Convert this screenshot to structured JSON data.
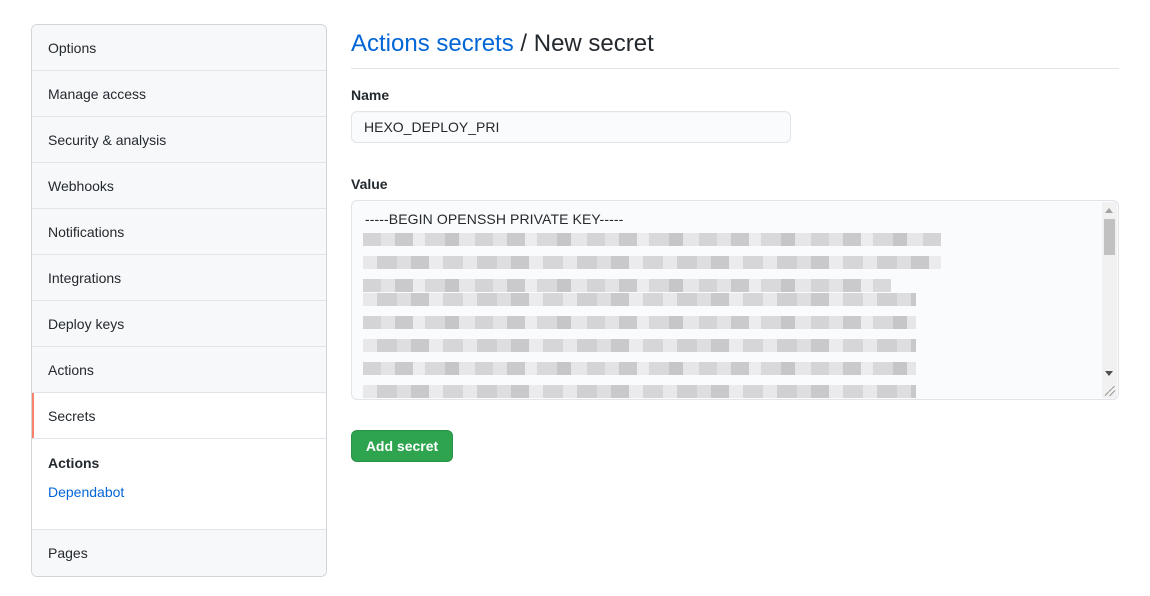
{
  "sidebar": {
    "items": [
      {
        "label": "Options"
      },
      {
        "label": "Manage access"
      },
      {
        "label": "Security & analysis"
      },
      {
        "label": "Webhooks"
      },
      {
        "label": "Notifications"
      },
      {
        "label": "Integrations"
      },
      {
        "label": "Deploy keys"
      },
      {
        "label": "Actions"
      },
      {
        "label": "Secrets",
        "selected": true
      }
    ],
    "group": {
      "title": "Actions",
      "link": "Dependabot"
    },
    "last_item": "Pages"
  },
  "header": {
    "breadcrumb_link": "Actions secrets",
    "separator": "/",
    "current": "New secret"
  },
  "form": {
    "name_label": "Name",
    "name_value": "HEXO_DEPLOY_PRI",
    "value_label": "Value",
    "value_first_line": "-----BEGIN OPENSSH PRIVATE KEY-----",
    "submit_label": "Add secret"
  },
  "colors": {
    "link": "#0366d6",
    "selected_marker": "#f9826c",
    "primary_button": "#2ea44f"
  }
}
